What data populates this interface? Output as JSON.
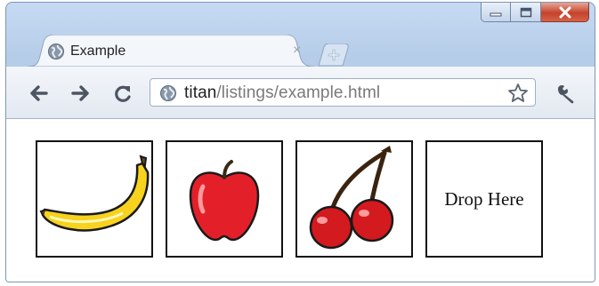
{
  "window": {
    "controls": [
      {
        "name": "minimize",
        "icon": "minimize-icon"
      },
      {
        "name": "maximize",
        "icon": "maximize-icon"
      },
      {
        "name": "close",
        "icon": "close-icon"
      }
    ]
  },
  "tab": {
    "title": "Example",
    "close_glyph": "×",
    "favicon": "globe-icon"
  },
  "toolbar": {
    "back_icon": "back-arrow-icon",
    "forward_icon": "forward-arrow-icon",
    "reload_icon": "reload-icon",
    "wrench_icon": "wrench-icon"
  },
  "address": {
    "host": "titan",
    "path": "/listings/example.html",
    "star_icon": "bookmark-star-icon"
  },
  "content": {
    "tiles": [
      {
        "name": "banana",
        "icon": "banana-image"
      },
      {
        "name": "apple",
        "icon": "apple-image"
      },
      {
        "name": "cherries",
        "icon": "cherries-image"
      }
    ],
    "drop_label": "Drop Here"
  },
  "colors": {
    "frame": "#b6cde9",
    "banana": "#f7d21e",
    "apple": "#e3202a",
    "cherry": "#d21a1f"
  }
}
